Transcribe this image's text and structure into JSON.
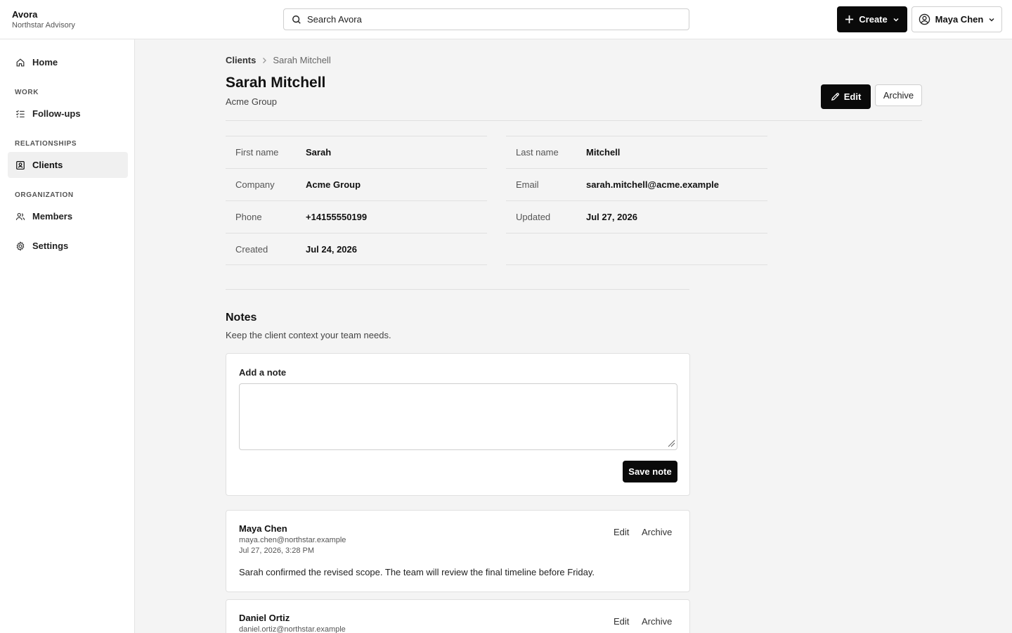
{
  "app": {
    "name": "Avora",
    "org": "Northstar Advisory"
  },
  "header": {
    "search_placeholder": "Search Avora",
    "create_label": "Create",
    "user_name": "Maya Chen"
  },
  "sidebar": {
    "home": "Home",
    "sections": {
      "work": "WORK",
      "relationships": "RELATIONSHIPS",
      "organization": "ORGANIZATION"
    },
    "follow_ups": "Follow-ups",
    "clients": "Clients",
    "members": "Members",
    "settings": "Settings",
    "active": "Clients"
  },
  "breadcrumb": {
    "parent": "Clients",
    "current": "Sarah Mitchell"
  },
  "client": {
    "name": "Sarah Mitchell",
    "company": "Acme Group",
    "edit_label": "Edit",
    "archive_label": "Archive"
  },
  "fields": {
    "left": [
      {
        "label": "First name",
        "value": "Sarah"
      },
      {
        "label": "Company",
        "value": "Acme Group"
      },
      {
        "label": "Phone",
        "value": "+14155550199"
      },
      {
        "label": "Created",
        "value": "Jul 24, 2026"
      }
    ],
    "right": [
      {
        "label": "Last name",
        "value": "Mitchell"
      },
      {
        "label": "Email",
        "value": "sarah.mitchell@acme.example"
      },
      {
        "label": "Updated",
        "value": "Jul 27, 2026"
      }
    ]
  },
  "notes": {
    "title": "Notes",
    "subtitle": "Keep the client context your team needs.",
    "add_label": "Add a note",
    "input_value": "",
    "save_label": "Save note",
    "edit_label": "Edit",
    "archive_label": "Archive",
    "items": [
      {
        "author": "Maya Chen",
        "email": "maya.chen@northstar.example",
        "time": "Jul 27, 2026, 3:28 PM",
        "body": "Sarah confirmed the revised scope. The team will review the final timeline before Friday."
      },
      {
        "author": "Daniel Ortiz",
        "email": "daniel.ortiz@northstar.example",
        "time": "",
        "body": ""
      }
    ]
  },
  "colors": {
    "primary": "#0a0a0a",
    "border": "#e0e0e0",
    "background": "#f4f4f4",
    "active_nav": "#f0f0f0"
  }
}
